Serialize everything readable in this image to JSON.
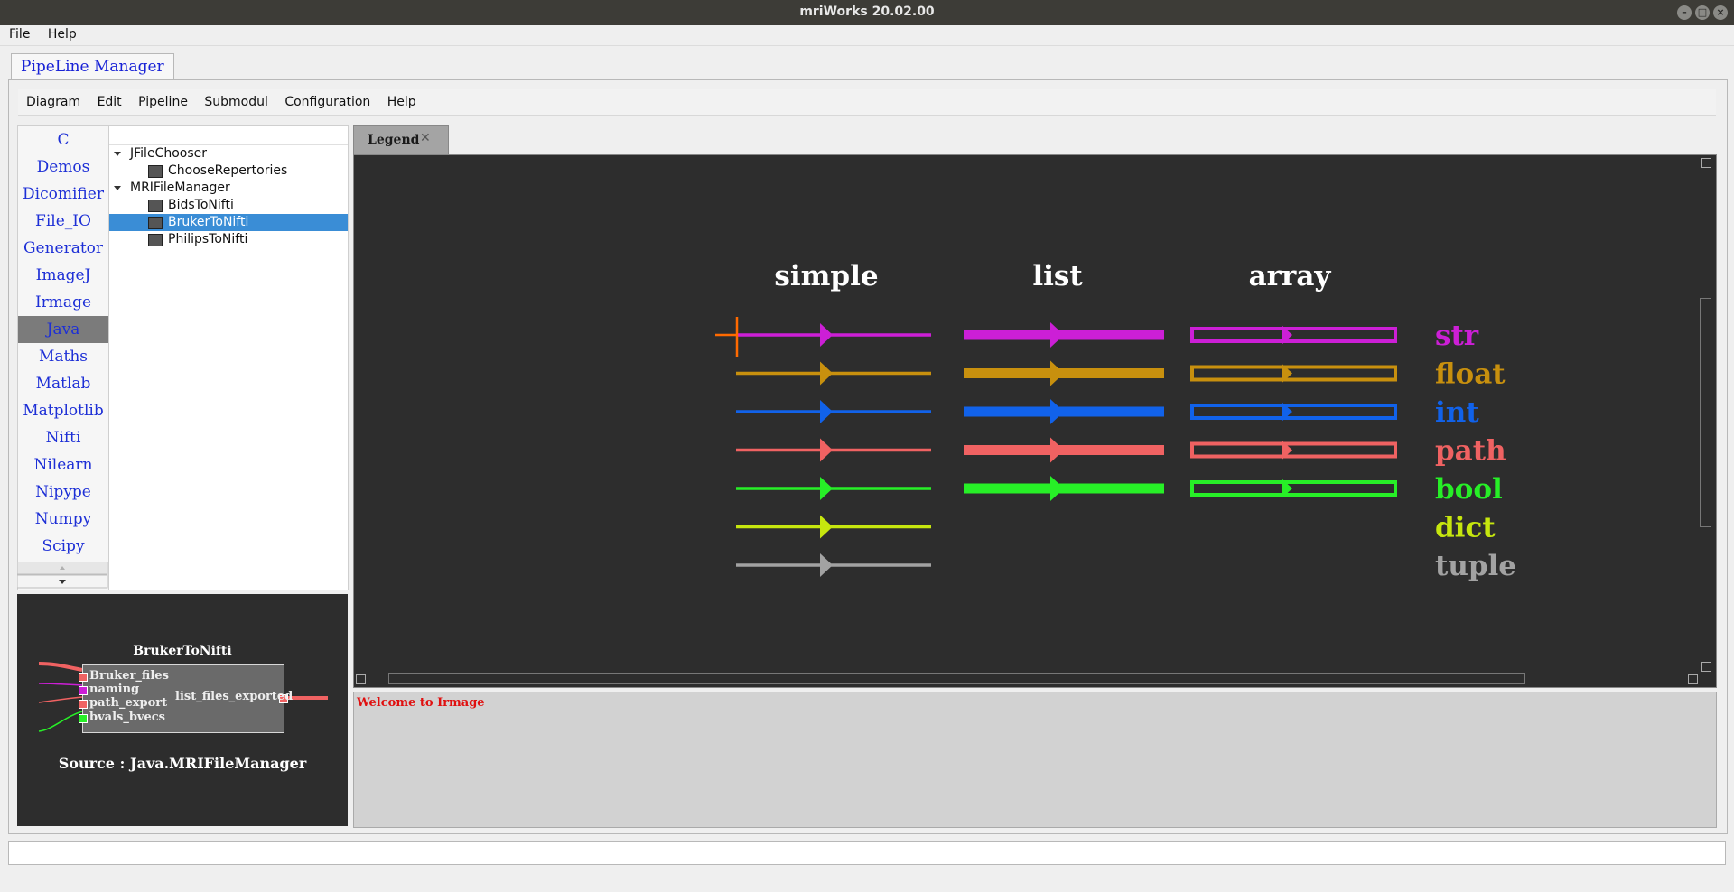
{
  "window": {
    "title": "mriWorks 20.02.00"
  },
  "menubar": {
    "items": [
      "File",
      "Help"
    ]
  },
  "main_tab": {
    "label": "PipeLine Manager"
  },
  "inner_menu": {
    "items": [
      "Diagram",
      "Edit",
      "Pipeline",
      "Submodul",
      "Configuration",
      "Help"
    ]
  },
  "categories": {
    "items": [
      "C",
      "Demos",
      "Dicomifier",
      "File_IO",
      "Generator",
      "ImageJ",
      "Irmage",
      "Java",
      "Maths",
      "Matlab",
      "Matplotlib",
      "Nifti",
      "Nilearn",
      "Nipype",
      "Numpy",
      "Scipy"
    ],
    "selected": "Java"
  },
  "tree": {
    "groups": [
      {
        "label": "JFileChooser",
        "children": [
          "ChooseRepertories"
        ]
      },
      {
        "label": "MRIFileManager",
        "children": [
          "BidsToNifti",
          "BrukerToNifti",
          "PhilipsToNifti"
        ]
      }
    ],
    "selected": "BrukerToNifti"
  },
  "preview": {
    "title": "BrukerToNifti",
    "inputs": [
      "Bruker_files",
      "naming",
      "path_export",
      "bvals_bvecs"
    ],
    "output": "list_files_exported",
    "source": "Source : Java.MRIFileManager"
  },
  "legend_tab": {
    "label": "Legend",
    "close_icon": "close-icon"
  },
  "legend": {
    "headers": [
      "simple",
      "list",
      "array"
    ],
    "types": [
      {
        "name": "str",
        "color": "#cc1fd6",
        "list": true,
        "array": true
      },
      {
        "name": "float",
        "color": "#c8900e",
        "list": true,
        "array": true
      },
      {
        "name": "int",
        "color": "#1162ea",
        "list": true,
        "array": true
      },
      {
        "name": "path",
        "color": "#f06262",
        "list": true,
        "array": true
      },
      {
        "name": "bool",
        "color": "#27ef27",
        "list": true,
        "array": true
      },
      {
        "name": "dict",
        "color": "#c6e60e",
        "list": false,
        "array": false
      },
      {
        "name": "tuple",
        "color": "#a2a2a2",
        "list": false,
        "array": false
      }
    ]
  },
  "log": {
    "message": "Welcome to Irmage"
  },
  "statusbar": {
    "text": ""
  }
}
